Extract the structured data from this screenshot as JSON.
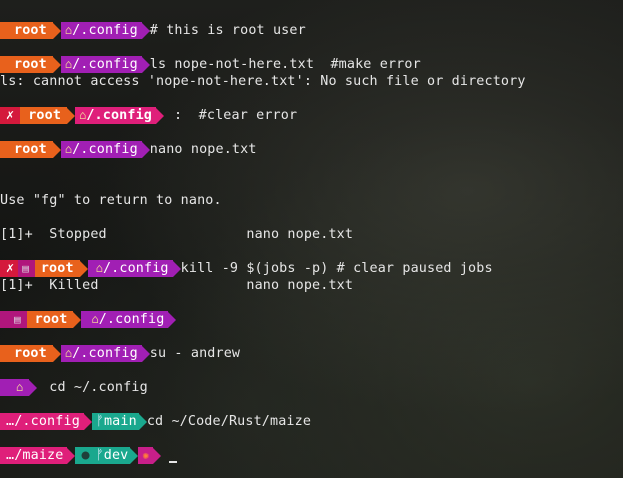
{
  "lines": [
    {
      "type": "prompt",
      "user": "root",
      "path": "/.config",
      "command": "# this is root user"
    },
    {
      "type": "prompt",
      "user": "root",
      "path": "/.config",
      "command": "ls nope-not-here.txt  #make error"
    },
    {
      "type": "output",
      "text": "ls: cannot access 'nope-not-here.txt': No such file or directory"
    },
    {
      "type": "prompt-error",
      "mark": "✗",
      "user": "root",
      "path": "/.config",
      "command": ":  #clear error"
    },
    {
      "type": "prompt",
      "user": "root",
      "path": "/.config",
      "command": "nano nope.txt"
    },
    {
      "type": "output",
      "text": "Use \"fg\" to return to nano."
    },
    {
      "type": "output",
      "text": "[1]+  Stopped                 nano nope.txt"
    },
    {
      "type": "prompt-error-job",
      "mark": "✗",
      "user": "root",
      "path": "/.config",
      "command": "kill -9 $(jobs -p) # clear paused jobs"
    },
    {
      "type": "output",
      "text": "[1]+  Killed                  nano nope.txt"
    },
    {
      "type": "prompt-job",
      "user": "root",
      "path": "/.config",
      "command": ""
    },
    {
      "type": "prompt",
      "user": "root",
      "path": "/.config",
      "command": "su - andrew"
    },
    {
      "type": "prompt-home",
      "command": "cd ~/.config"
    },
    {
      "type": "prompt-git",
      "path": "…/.config",
      "branch": "main",
      "command": "cd ~/Code/Rust/maize"
    },
    {
      "type": "prompt-git-dirty",
      "path": "…/maize",
      "dot": "●",
      "branch": "dev",
      "crab": "🦀",
      "command": ""
    }
  ],
  "icons": {
    "home": "house-icon",
    "job": "clipboard-icon",
    "branch": "git-branch-icon",
    "crab": "crab-icon"
  },
  "colors": {
    "root": "#e8611c",
    "path": "#a11fb4",
    "error": "#d4193c",
    "git": "#1aa88e",
    "pink": "#df1f7a"
  },
  "git_branch_glyph": "ᚠ",
  "home_glyph": "🏠"
}
